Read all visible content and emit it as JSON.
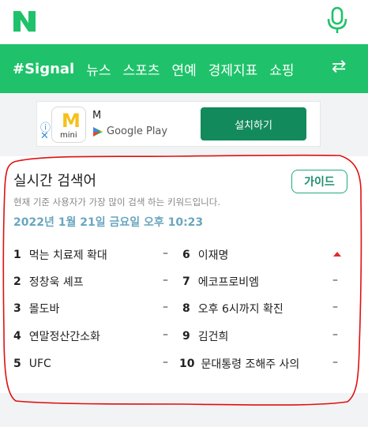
{
  "header": {
    "logo": "N",
    "logo_color": "#1fc26a",
    "mic_icon": "mic-icon"
  },
  "nav": {
    "items": [
      {
        "label": "#Signal",
        "active": true
      },
      {
        "label": "뉴스"
      },
      {
        "label": "스포츠"
      },
      {
        "label": "연예"
      },
      {
        "label": "경제지표"
      },
      {
        "label": "쇼핑"
      }
    ],
    "more_icon": "swap-icon",
    "more_glyph": "⇄",
    "bg": "#1fc26a"
  },
  "ad": {
    "info_icon": "ⓘ",
    "close_icon": "✕",
    "app_letter": "M",
    "app_sub": "mini",
    "app_name": "M",
    "store": "Google Play",
    "cta": "설치하기",
    "cta_color": "#138a5c"
  },
  "realtime": {
    "title": "실시간 검색어",
    "guide_label": "가이드",
    "description": "현재 기준 사용자가 가장 많이 검색 하는 키워드입니다.",
    "timestamp": "2022년 1월 21일 금요일 오후 10:23",
    "left": [
      {
        "rank": "1",
        "keyword": "먹는 치료제 확대",
        "trend": "–"
      },
      {
        "rank": "2",
        "keyword": "정창욱 셰프",
        "trend": "–"
      },
      {
        "rank": "3",
        "keyword": "몰도바",
        "trend": "–"
      },
      {
        "rank": "4",
        "keyword": "연말정산간소화",
        "trend": "–"
      },
      {
        "rank": "5",
        "keyword": "UFC",
        "trend": "–"
      }
    ],
    "right": [
      {
        "rank": "6",
        "keyword": "이재명",
        "trend": "up"
      },
      {
        "rank": "7",
        "keyword": "에코프로비엠",
        "trend": "–"
      },
      {
        "rank": "8",
        "keyword": "오후 6시까지 확진",
        "trend": "–"
      },
      {
        "rank": "9",
        "keyword": "김건희",
        "trend": "–"
      },
      {
        "rank": "10",
        "keyword": "문대통령 조해주 사의",
        "trend": "–"
      }
    ],
    "trend_up_color": "#e02b2b"
  },
  "annotation": {
    "color": "#e01010"
  }
}
